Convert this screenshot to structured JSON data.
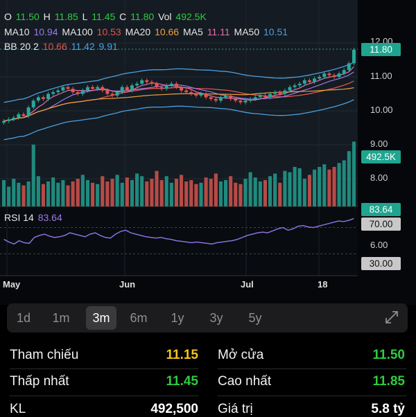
{
  "legend": {
    "ohlc": {
      "o_label": "O",
      "o": "11.50",
      "h_label": "H",
      "h": "11.85",
      "l_label": "L",
      "l": "11.45",
      "c_label": "C",
      "c": "11.80",
      "vol_label": "Vol",
      "vol": "492.5K"
    },
    "ma_line": [
      {
        "label": "MA10",
        "value": "10.94",
        "color": "#9b7be8"
      },
      {
        "label": "MA100",
        "value": "10.53",
        "color": "#e0574f"
      },
      {
        "label": "MA20",
        "value": "10.66",
        "color": "#f0a040"
      },
      {
        "label": "MA5",
        "value": "11.11",
        "color": "#e86fb0"
      },
      {
        "label": "MA50",
        "value": "10.51",
        "color": "#4da0e0"
      }
    ],
    "bb": {
      "label": "BB 20 2",
      "v1": "10.66",
      "v2": "11.42",
      "v3": "9.91"
    }
  },
  "price_axis": {
    "labels": [
      "12.00",
      "11.00",
      "10.00",
      "9.00",
      "8.00"
    ],
    "price_tag": "11.80",
    "volume_tag": "492.5K"
  },
  "rsi": {
    "label": "RSI 14",
    "value": "83.64",
    "tag": "83.64",
    "upper": "70.00",
    "lower": "30.00",
    "mid": "6.00"
  },
  "x_axis": {
    "labels": [
      "May",
      "Jun",
      "Jul",
      "18"
    ]
  },
  "ranges": {
    "items": [
      "1d",
      "1m",
      "3m",
      "6m",
      "1y",
      "3y",
      "5y"
    ],
    "active": "3m"
  },
  "stats": {
    "tham_chieu_label": "Tham chiếu",
    "tham_chieu": "11.15",
    "mo_cua_label": "Mở cửa",
    "mo_cua": "11.50",
    "thap_nhat_label": "Thấp nhất",
    "thap_nhat": "11.45",
    "cao_nhat_label": "Cao nhất",
    "cao_nhat": "11.85",
    "kl_label": "KL",
    "kl": "492,500",
    "gia_tri_label": "Giá trị",
    "gia_tri": "5.8 tỷ"
  },
  "colors": {
    "up": "#2aa89a",
    "down": "#e0574f",
    "accent_yellow": "#f5c518",
    "accent_green": "#2ecc40"
  },
  "chart_data": {
    "type": "candlestick",
    "price_series": [
      9.7,
      9.75,
      9.8,
      9.9,
      9.85,
      10.1,
      10.3,
      10.4,
      10.35,
      10.5,
      10.55,
      10.6,
      10.7,
      10.65,
      10.55,
      10.5,
      10.6,
      10.7,
      10.65,
      10.7,
      10.6,
      10.5,
      10.45,
      10.55,
      10.7,
      10.6,
      10.75,
      10.8,
      10.9,
      10.85,
      10.8,
      10.7,
      10.65,
      10.75,
      10.8,
      10.7,
      10.6,
      10.55,
      10.5,
      10.45,
      10.5,
      10.4,
      10.35,
      10.3,
      10.4,
      10.45,
      10.35,
      10.3,
      10.25,
      10.3,
      10.35,
      10.4,
      10.45,
      10.4,
      10.5,
      10.55,
      10.5,
      10.6,
      10.7,
      10.75,
      10.8,
      10.9,
      10.85,
      10.95,
      11.0,
      11.1,
      11.05,
      11.0,
      11.1,
      11.2,
      11.4,
      11.8
    ],
    "volume_k": [
      200,
      150,
      210,
      180,
      160,
      190,
      470,
      230,
      170,
      190,
      220,
      180,
      200,
      160,
      190,
      210,
      240,
      200,
      180,
      170,
      230,
      190,
      210,
      240,
      180,
      220,
      200,
      250,
      230,
      190,
      210,
      270,
      200,
      230,
      180,
      210,
      240,
      190,
      200,
      170,
      180,
      220,
      210,
      250,
      190,
      200,
      230,
      180,
      170,
      210,
      260,
      220,
      190,
      200,
      230,
      250,
      180,
      270,
      260,
      300,
      290,
      210,
      240,
      280,
      300,
      320,
      280,
      300,
      330,
      350,
      420,
      492.5
    ],
    "rsi_series": [
      52,
      48,
      45,
      50,
      47,
      46,
      55,
      58,
      60,
      57,
      55,
      56,
      58,
      62,
      60,
      58,
      56,
      60,
      62,
      58,
      55,
      54,
      60,
      64,
      66,
      62,
      60,
      58,
      56,
      55,
      54,
      55,
      53,
      52,
      50,
      49,
      48,
      47,
      48,
      47,
      46,
      45,
      47,
      48,
      49,
      50,
      52,
      55,
      58,
      60,
      62,
      63,
      62,
      65,
      68,
      70,
      66,
      68,
      72,
      73,
      71,
      70,
      72,
      74,
      76,
      78,
      80,
      79,
      81,
      83.64
    ]
  }
}
